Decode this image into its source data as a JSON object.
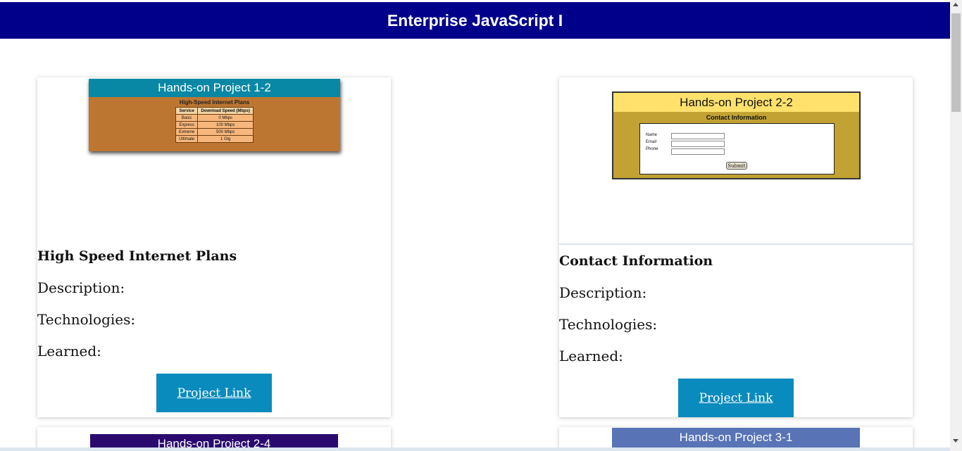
{
  "header": {
    "title": "Enterprise JavaScript I"
  },
  "cards": [
    {
      "screenshot": {
        "heading": "Hands-on Project 1-2",
        "subheading": "High-Speed Internet Plans",
        "columns": [
          "Service",
          "Download Speed (Mbps)"
        ],
        "rows": [
          [
            "Basic",
            "0 Mbps"
          ],
          [
            "Express",
            "100 Mbps"
          ],
          [
            "Extreme",
            "500 Mbps"
          ],
          [
            "Ultimate",
            "1 Gig"
          ]
        ]
      },
      "title": "High Speed Internet Plans",
      "description": "Description:",
      "technologies": "Technologies:",
      "learned": "Learned:",
      "link_label": "Project Link"
    },
    {
      "screenshot": {
        "heading": "Hands-on Project 2-2",
        "subheading": "Contact Information",
        "fields": [
          "Name",
          "Email",
          "Phone"
        ],
        "submit_label": "Submit"
      },
      "title": "Contact Information",
      "description": "Description:",
      "technologies": "Technologies:",
      "learned": "Learned:",
      "link_label": "Project Link"
    },
    {
      "screenshot": {
        "heading": "Hands-on Project 2-4"
      }
    },
    {
      "screenshot": {
        "heading": "Hands-on Project 3-1"
      }
    }
  ],
  "colors": {
    "header_bg": "#00008b",
    "button_bg": "#0a8bbd"
  }
}
